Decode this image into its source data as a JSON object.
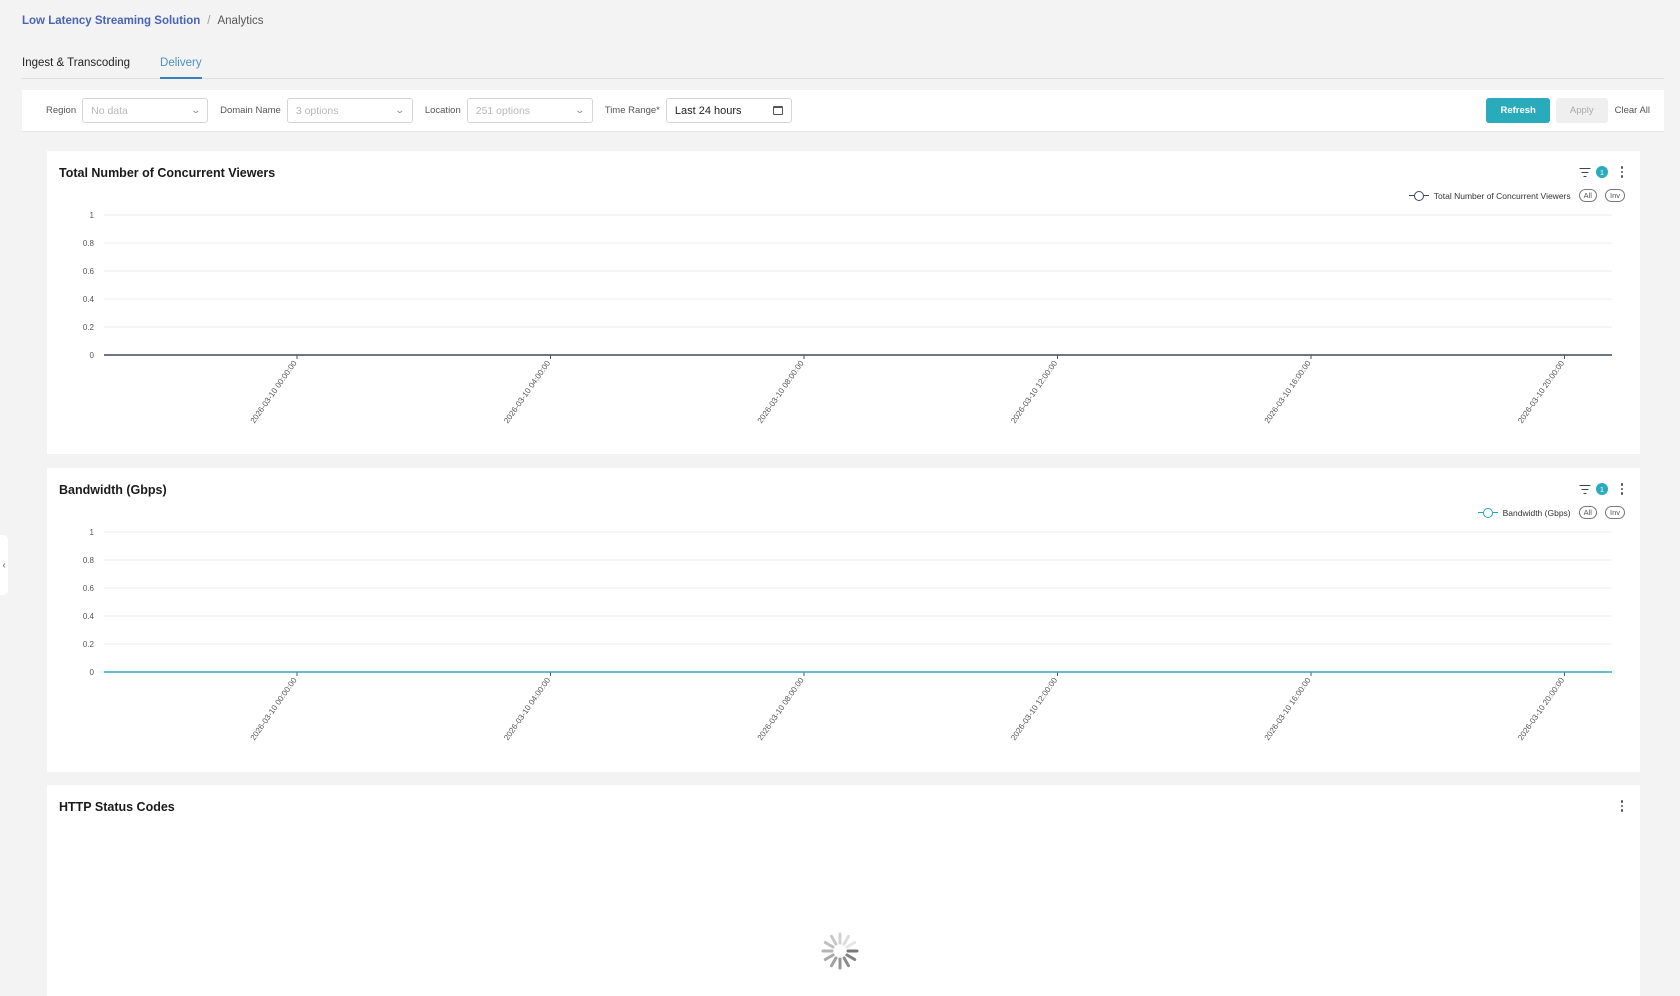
{
  "breadcrumb": {
    "root": "Low Latency Streaming Solution",
    "separator": "/",
    "current": "Analytics"
  },
  "tabs": [
    {
      "label": "Ingest & Transcoding",
      "active": false
    },
    {
      "label": "Delivery",
      "active": true
    }
  ],
  "filters": {
    "region": {
      "label": "Region",
      "placeholder": "No data"
    },
    "domain": {
      "label": "Domain Name",
      "placeholder": "3 options"
    },
    "location": {
      "label": "Location",
      "placeholder": "251 options"
    },
    "time_range": {
      "label": "Time Range",
      "required_mark": "*",
      "value": "Last 24 hours"
    },
    "refresh_label": "Refresh",
    "apply_label": "Apply",
    "clear_label": "Clear All"
  },
  "panels": {
    "viewers": {
      "title": "Total Number of Concurrent Viewers",
      "badge": "1",
      "legend": "Total Number of Concurrent Viewers",
      "all_label": "All",
      "inv_label": "Inv"
    },
    "bandwidth": {
      "title": "Bandwidth (Gbps)",
      "badge": "1",
      "legend": "Bandwidth (Gbps)",
      "all_label": "All",
      "inv_label": "Inv"
    },
    "http": {
      "title": "HTTP Status Codes",
      "loading": true
    }
  },
  "colors": {
    "accent": "#2aabbb",
    "viewers_line": "#3c4858",
    "bandwidth_line": "#2aa7c0",
    "link": "#4a64b5"
  },
  "chart_data": [
    {
      "type": "line",
      "title": "Total Number of Concurrent Viewers",
      "x_ticks": [
        "2026-03-10 00:00:00",
        "2026-03-10 04:00:00",
        "2026-03-10 08:00:00",
        "2026-03-10 12:00:00",
        "2026-03-10 16:00:00",
        "2026-03-10 20:00:00"
      ],
      "y_ticks": [
        "1",
        "0.8",
        "0.6",
        "0.4",
        "0.2",
        "0"
      ],
      "ylim": [
        0,
        1
      ],
      "grid": true,
      "legend_position": "top-right",
      "series": [
        {
          "name": "Total Number of Concurrent Viewers",
          "values": [
            0,
            0,
            0,
            0,
            0,
            0
          ],
          "color": "#3c4858"
        }
      ]
    },
    {
      "type": "line",
      "title": "Bandwidth (Gbps)",
      "x_ticks": [
        "2026-03-10 00:00:00",
        "2026-03-10 04:00:00",
        "2026-03-10 08:00:00",
        "2026-03-10 12:00:00",
        "2026-03-10 16:00:00",
        "2026-03-10 20:00:00"
      ],
      "y_ticks": [
        "1",
        "0.8",
        "0.6",
        "0.4",
        "0.2",
        "0"
      ],
      "ylim": [
        0,
        1
      ],
      "grid": true,
      "legend_position": "top-right",
      "series": [
        {
          "name": "Bandwidth (Gbps)",
          "values": [
            0,
            0,
            0,
            0,
            0,
            0
          ],
          "color": "#2aa7c0"
        }
      ]
    }
  ]
}
